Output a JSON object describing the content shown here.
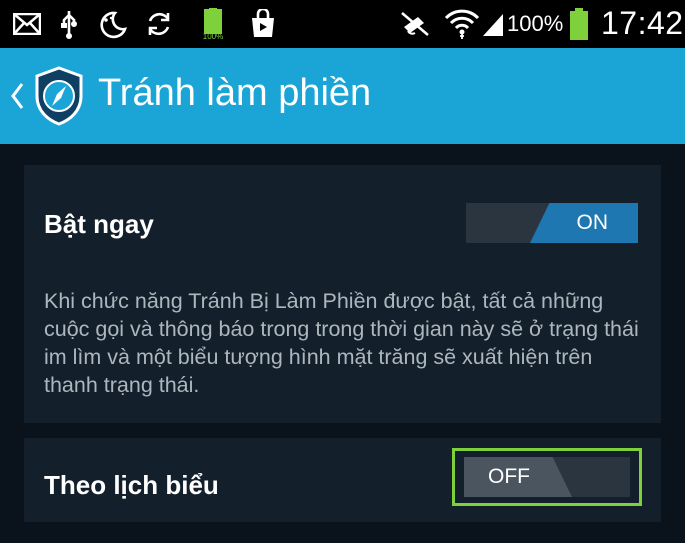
{
  "status_bar": {
    "icons": [
      "mail-icon",
      "usb-icon",
      "night-mode-icon",
      "sync-icon",
      "android-battery-icon",
      "shopping-bag-icon",
      "mute-icon",
      "wifi-icon",
      "signal-icon",
      "battery-icon"
    ],
    "mini_battery_label": "100%",
    "battery_percent": "100%",
    "time": "17:42"
  },
  "action_bar": {
    "title": "Tránh làm phiền",
    "back_icon": "chevron-left-icon",
    "logo_icon": "shield-compass-icon"
  },
  "settings": {
    "enable_now": {
      "label": "Bật ngay",
      "toggle_state": "ON",
      "description": "Khi chức năng Tránh Bị Làm Phiền được bật, tất cả những cuộc gọi và thông báo trong trong thời gian này sẽ ở trạng thái im lìm và một biểu tượng hình mặt trăng sẽ xuất hiện trên thanh trạng thái."
    },
    "schedule": {
      "label": "Theo lịch biểu",
      "toggle_state": "OFF"
    }
  },
  "colors": {
    "action_bar": "#1ba5d6",
    "toggle_on": "#1e77b0",
    "highlight": "#7ed13a",
    "background": "#0a131c",
    "card": "#13202c"
  }
}
